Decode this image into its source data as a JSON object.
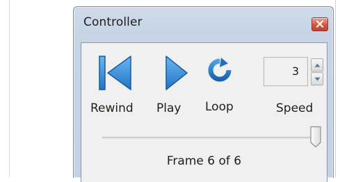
{
  "window": {
    "title": "Controller"
  },
  "controls": {
    "rewind_label": "Rewind",
    "play_label": "Play",
    "loop_label": "Loop",
    "speed_label": "Speed",
    "rewind_icon": "skip-to-start-icon",
    "play_icon": "play-triangle-icon",
    "loop_icon": "loop-arrow-icon"
  },
  "speed": {
    "value": "3"
  },
  "slider": {
    "current_frame": 6,
    "total_frames": 6,
    "position_fraction": 1.0
  },
  "status": {
    "frame_text": "Frame 6 of 6"
  },
  "colors": {
    "icon_fill": "#2f86d4",
    "icon_stroke": "#1a5a99",
    "titlebar": "#c6d4e6",
    "panel": "#f0f0f0",
    "close_button": "#d5553f"
  }
}
